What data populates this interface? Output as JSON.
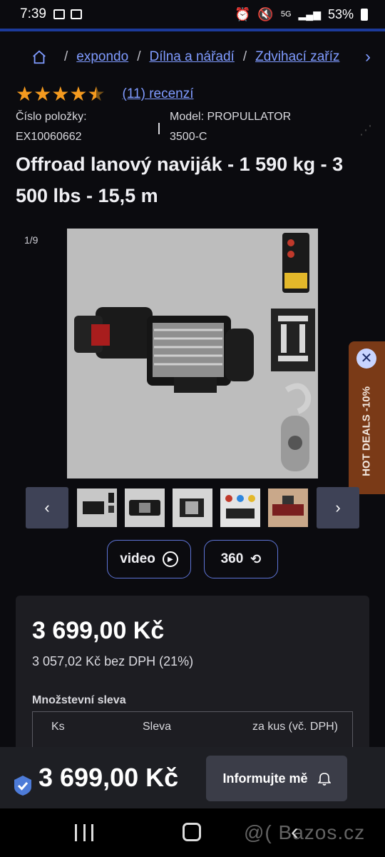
{
  "status_bar": {
    "time": "7:39",
    "network": "5G",
    "battery": "53%"
  },
  "breadcrumb": {
    "items": [
      "expondo",
      "Dílna a nářadí",
      "Zdvihací zaříz"
    ],
    "separator": "/"
  },
  "rating": {
    "value": 4.5,
    "reviews_label": "(11) recenzí"
  },
  "item": {
    "number_label": "Číslo položky:",
    "number_value": "EX10060662",
    "model_label": "Model: PROPULLATOR",
    "model_value": "3500-C"
  },
  "product_title": "Offroad lanový naviják - 1 590 kg - 3 500 lbs - 15,5 m",
  "gallery": {
    "counter": "1/9",
    "thumbnail_count": 5
  },
  "hot_deals": {
    "label": "HOT DEALS -10%"
  },
  "media": {
    "video_label": "video",
    "view360_label": "360"
  },
  "price": {
    "gross": "3 699,00 Kč",
    "net": "3 057,02 Kč bez DPH (21%)",
    "quantity_discount_title": "Množstevní sleva",
    "table_headers": [
      "Ks",
      "Sleva",
      "za kus (vč. DPH)"
    ]
  },
  "bottom_bar": {
    "price": "3 699,00 Kč",
    "notify_label": "Informujte mě"
  },
  "watermark": "@( Bazos.cz",
  "colors": {
    "accent_link": "#7f9bff",
    "star": "#f49a1f",
    "hot_deals_bg": "#7a3a17",
    "background": "#0b0b0f"
  }
}
